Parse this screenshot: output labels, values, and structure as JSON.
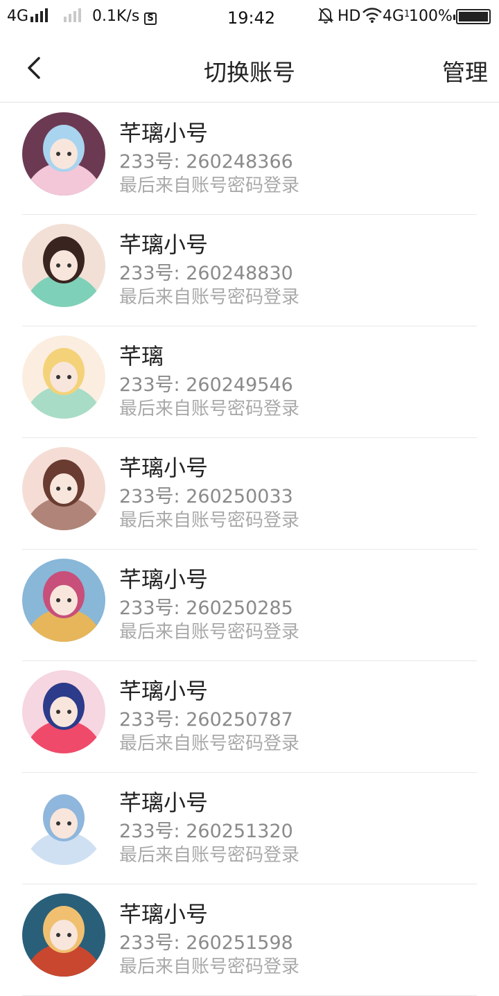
{
  "status_bar": {
    "network1": "4G",
    "speed": "0.1K/s",
    "s_icon_label": "S",
    "time": "19:42",
    "hd": "HD",
    "network2": "4G",
    "network2_sub": "1",
    "battery": "100%"
  },
  "header": {
    "title": "切换账号",
    "manage_label": "管理"
  },
  "accounts": [
    {
      "name": "芊璃小号",
      "uid": "233号: 260248366",
      "source": "最后来自账号密码登录",
      "colors": [
        "#f3c6d8",
        "#a9d4ef",
        "#6b3a52"
      ]
    },
    {
      "name": "芊璃小号",
      "uid": "233号: 260248830",
      "source": "最后来自账号密码登录",
      "colors": [
        "#7fd0b8",
        "#3a2420",
        "#f2e0d6"
      ]
    },
    {
      "name": "芊璃",
      "uid": "233号: 260249546",
      "source": "最后来自账号密码登录",
      "colors": [
        "#a8dcc6",
        "#f4d27a",
        "#fbeee0"
      ]
    },
    {
      "name": "芊璃小号",
      "uid": "233号: 260250033",
      "source": "最后来自账号密码登录",
      "colors": [
        "#b08478",
        "#6a3b30",
        "#f5ddd6"
      ]
    },
    {
      "name": "芊璃小号",
      "uid": "233号: 260250285",
      "source": "最后来自账号密码登录",
      "colors": [
        "#e7b65a",
        "#c74f7a",
        "#88b7d8"
      ]
    },
    {
      "name": "芊璃小号",
      "uid": "233号: 260250787",
      "source": "最后来自账号密码登录",
      "colors": [
        "#f04a6a",
        "#2c3b8a",
        "#f6d6e0"
      ]
    },
    {
      "name": "芊璃小号",
      "uid": "233号: 260251320",
      "source": "最后来自账号密码登录",
      "colors": [
        "#cfe0f3",
        "#8fb6dc",
        "#ffffff"
      ]
    },
    {
      "name": "芊璃小号",
      "uid": "233号: 260251598",
      "source": "最后来自账号密码登录",
      "colors": [
        "#c9472f",
        "#f0c070",
        "#2a5f7a"
      ]
    }
  ]
}
